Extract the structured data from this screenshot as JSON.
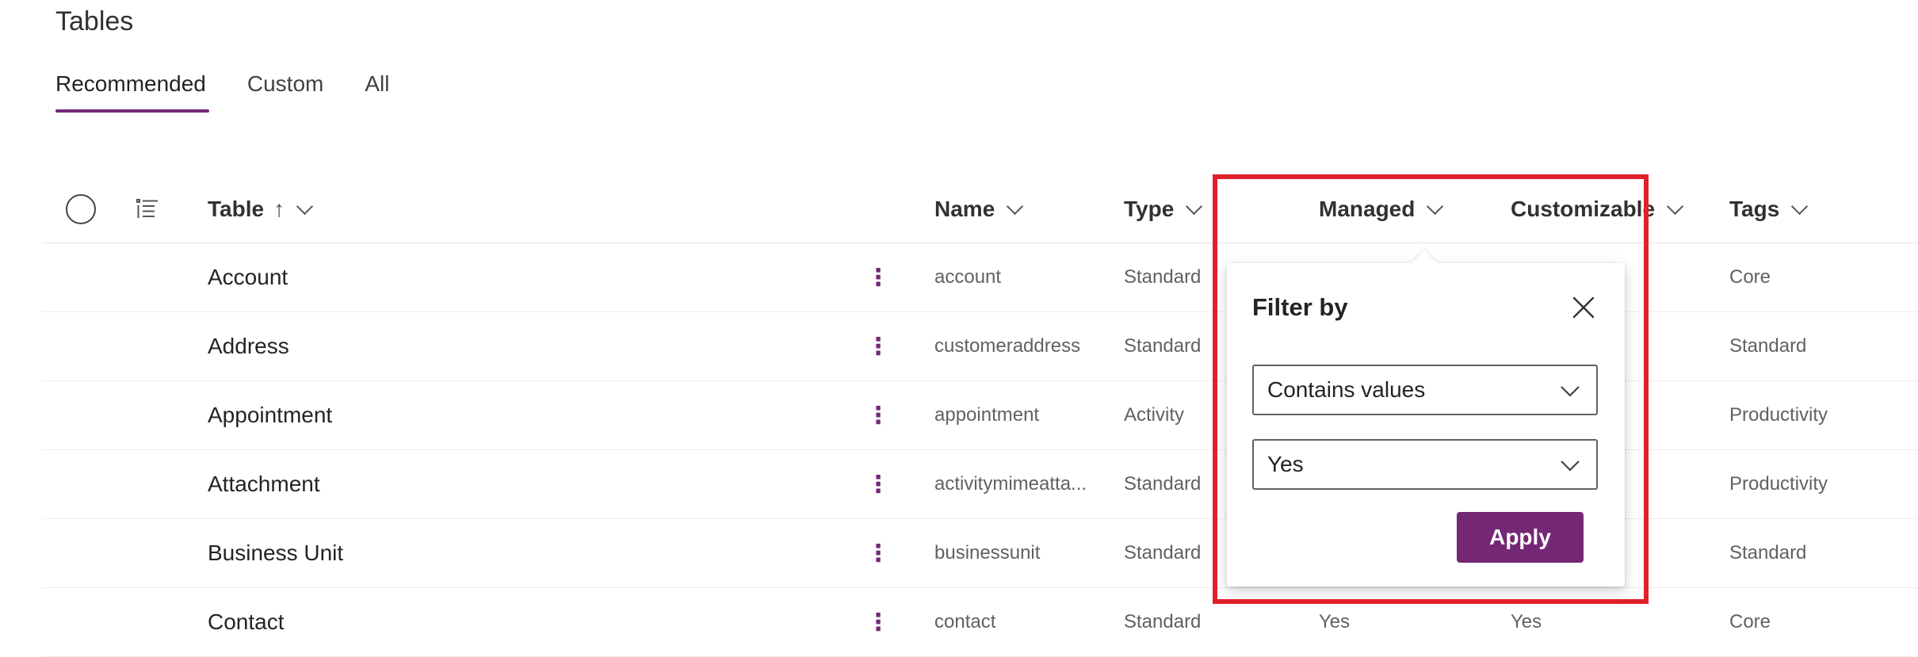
{
  "page": {
    "title": "Tables"
  },
  "tabs": [
    {
      "label": "Recommended",
      "active": true
    },
    {
      "label": "Custom",
      "active": false
    },
    {
      "label": "All",
      "active": false
    }
  ],
  "columns": {
    "table": "Table",
    "sort_indicator": "↑",
    "name": "Name",
    "type": "Type",
    "managed": "Managed",
    "customizable": "Customizable",
    "tags": "Tags"
  },
  "more_glyph": "⋮",
  "rows": [
    {
      "table": "Account",
      "name": "account",
      "type": "Standard",
      "managed": "",
      "customizable": "",
      "tags": "Core"
    },
    {
      "table": "Address",
      "name": "customeraddress",
      "type": "Standard",
      "managed": "",
      "customizable": "",
      "tags": "Standard"
    },
    {
      "table": "Appointment",
      "name": "appointment",
      "type": "Activity",
      "managed": "",
      "customizable": "",
      "tags": "Productivity"
    },
    {
      "table": "Attachment",
      "name": "activitymimeatta...",
      "type": "Standard",
      "managed": "",
      "customizable": "",
      "tags": "Productivity"
    },
    {
      "table": "Business Unit",
      "name": "businessunit",
      "type": "Standard",
      "managed": "",
      "customizable": "",
      "tags": "Standard"
    },
    {
      "table": "Contact",
      "name": "contact",
      "type": "Standard",
      "managed": "Yes",
      "customizable": "Yes",
      "tags": "Core"
    }
  ],
  "filter_popup": {
    "title": "Filter by",
    "operator": "Contains values",
    "value": "Yes",
    "apply_label": "Apply"
  },
  "colors": {
    "accent": "#742774",
    "highlight": "#e0202a"
  }
}
